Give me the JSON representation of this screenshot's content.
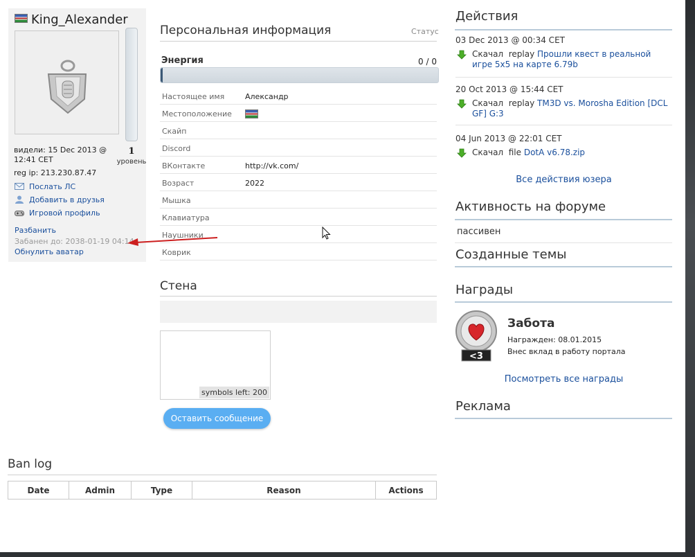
{
  "profile": {
    "username": "King_Alexander",
    "last_seen": "видели: 15 Dec 2013 @ 12:41 CET",
    "reg_ip": "reg ip: 213.230.87.47",
    "level": "1",
    "level_label": "уровень",
    "actions": [
      "Послать ЛС",
      "Добавить в друзья",
      "Игровой профиль"
    ],
    "unban_link": "Разбанить",
    "banned_until": "Забанен до: 2038-01-19 04:14",
    "reset_avatar": "Обнулить аватар"
  },
  "personal": {
    "title": "Персональная информация",
    "status_label": "Статус",
    "energy_label": "Энергия",
    "energy_value": "0 / 0",
    "energy_fraction": 0,
    "rows": [
      {
        "key": "Настоящее имя",
        "value": "Александр"
      },
      {
        "key": "Местоположение",
        "value": "",
        "flag": true
      },
      {
        "key": "Скайп",
        "value": ""
      },
      {
        "key": "Discord",
        "value": ""
      },
      {
        "key": "ВКонтакте",
        "value": "http://vk.com/"
      },
      {
        "key": "Возраст",
        "value": "2022"
      },
      {
        "key": "Мышка",
        "value": ""
      },
      {
        "key": "Клавиатура",
        "value": ""
      },
      {
        "key": "Наушники",
        "value": ""
      },
      {
        "key": "Коврик",
        "value": ""
      }
    ]
  },
  "wall": {
    "title": "Стена",
    "counter": "symbols left: 200",
    "post_button": "Оставить сообщение"
  },
  "banlog": {
    "title": "Ban log",
    "columns": [
      "Date",
      "Admin",
      "Type",
      "Reason",
      "Actions"
    ]
  },
  "actions": {
    "title": "Действия",
    "items": [
      {
        "date": "03 Dec 2013 @ 00:34 CET",
        "verb": "Скачал",
        "kind": "replay",
        "link": "Прошли квест в реальной игре 5x5 на карте 6.79b"
      },
      {
        "date": "20 Oct 2013 @ 15:44 CET",
        "verb": "Скачал",
        "kind": "replay",
        "link": "TM3D vs. Morosha Edition [DCL GF] G:3"
      },
      {
        "date": "04 Jun 2013 @ 22:01 CET",
        "verb": "Скачал",
        "kind": "file",
        "link": "DotA v6.78.zip"
      }
    ],
    "all_link": "Все действия юзера"
  },
  "forum": {
    "title": "Активность на форуме",
    "status": "пассивен"
  },
  "topics": {
    "title": "Созданные темы"
  },
  "awards": {
    "title": "Награды",
    "name": "Забота",
    "badge_text": "<3",
    "date": "Награжден: 08.01.2015",
    "desc": "Внес вклад в работу портала",
    "all_link": "Посмотреть все награды"
  },
  "ads": {
    "title": "Реклама"
  },
  "colors": {
    "link": "#1a4f9c",
    "button": "#5aaef2",
    "header_rule": "#b8cad9",
    "arrow": "#cc1f1f",
    "download_arrow": "#4caf28"
  }
}
